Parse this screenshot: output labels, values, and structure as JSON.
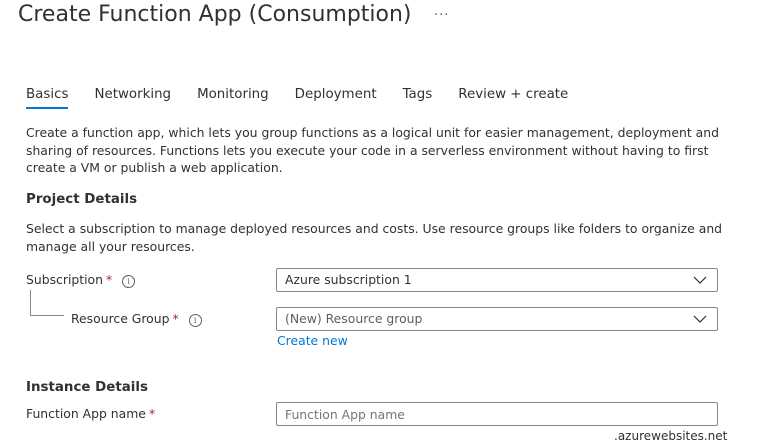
{
  "page": {
    "title": "Create Function App (Consumption)",
    "more_label": "···"
  },
  "tabs": [
    {
      "label": "Basics",
      "active": true
    },
    {
      "label": "Networking",
      "active": false
    },
    {
      "label": "Monitoring",
      "active": false
    },
    {
      "label": "Deployment",
      "active": false
    },
    {
      "label": "Tags",
      "active": false
    },
    {
      "label": "Review + create",
      "active": false
    }
  ],
  "intro": "Create a function app, which lets you group functions as a logical unit for easier management, deployment and sharing of resources. Functions lets you execute your code in a serverless environment without having to first create a VM or publish a web application.",
  "project": {
    "heading": "Project Details",
    "description": "Select a subscription to manage deployed resources and costs. Use resource groups like folders to organize and manage all your resources.",
    "subscription_label": "Subscription",
    "subscription_value": "Azure subscription 1",
    "resource_group_label": "Resource Group",
    "resource_group_value": "(New) Resource group",
    "create_new_label": "Create new"
  },
  "instance": {
    "heading": "Instance Details",
    "name_label": "Function App name",
    "name_placeholder": "Function App name",
    "name_suffix": ".azurewebsites.net"
  },
  "common": {
    "required_mark": "*",
    "info_glyph": "i"
  },
  "colors": {
    "accent": "#0078d4",
    "required": "#a4262c",
    "border": "#8a8886"
  }
}
